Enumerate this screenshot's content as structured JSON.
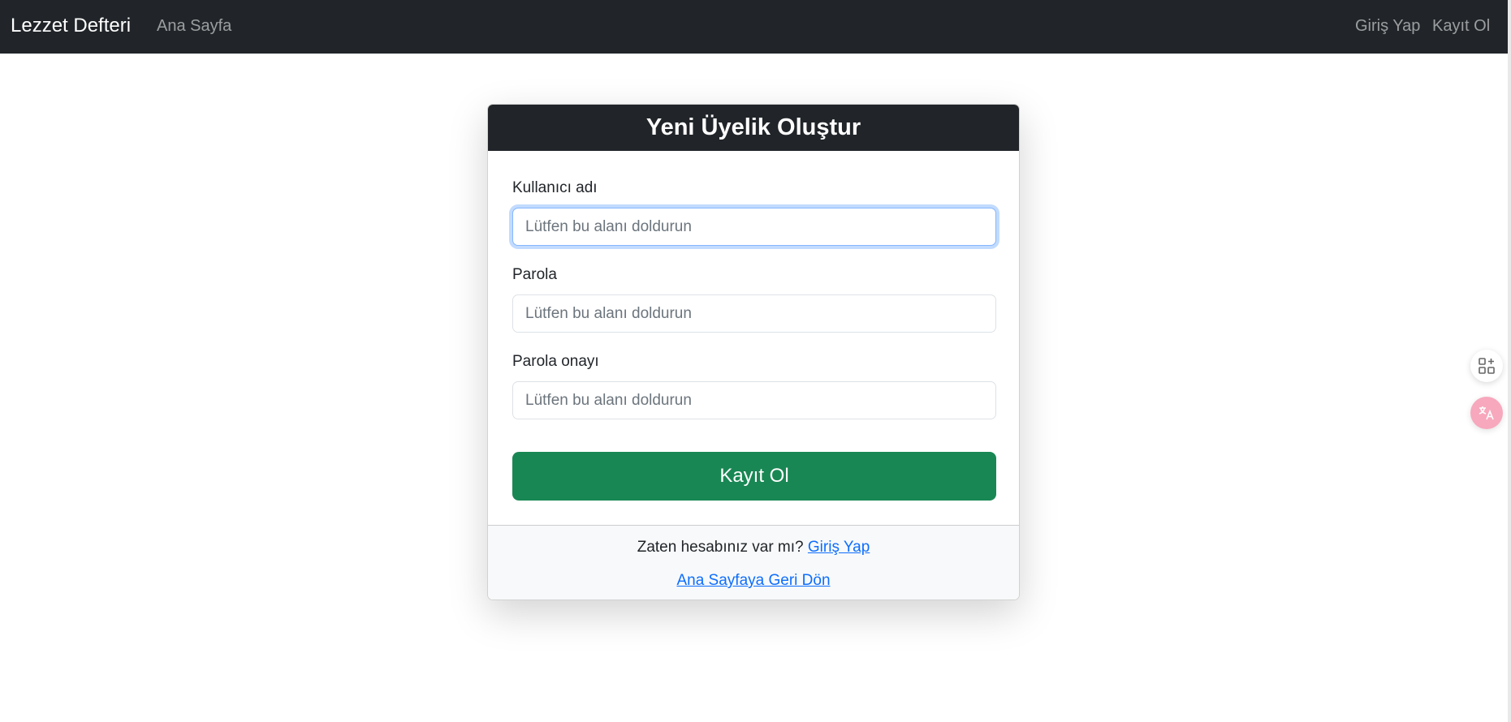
{
  "navbar": {
    "brand": "Lezzet Defteri",
    "home_link": "Ana Sayfa",
    "login_link": "Giriş Yap",
    "register_link": "Kayıt Ol"
  },
  "form": {
    "title": "Yeni Üyelik Oluştur",
    "fields": [
      {
        "label": "Kullanıcı adı",
        "placeholder": "Lütfen bu alanı doldurun",
        "value": "",
        "focused": true
      },
      {
        "label": "Parola",
        "placeholder": "Lütfen bu alanı doldurun",
        "value": ""
      },
      {
        "label": "Parola onayı",
        "placeholder": "Lütfen bu alanı doldurun",
        "value": ""
      }
    ],
    "submit_label": "Kayıt Ol"
  },
  "footer": {
    "question": "Zaten hesabınız var mı?",
    "login_link": "Giriş Yap",
    "back_link": "Ana Sayfaya Geri Dön"
  },
  "side_widgets": {
    "apps_icon": "apps-add-icon",
    "translate_icon": "translate-icon"
  },
  "colors": {
    "navbar_bg": "#212529",
    "submit_bg": "#198754",
    "link": "#0d6efd",
    "translate_bg": "#f7a8bd"
  }
}
